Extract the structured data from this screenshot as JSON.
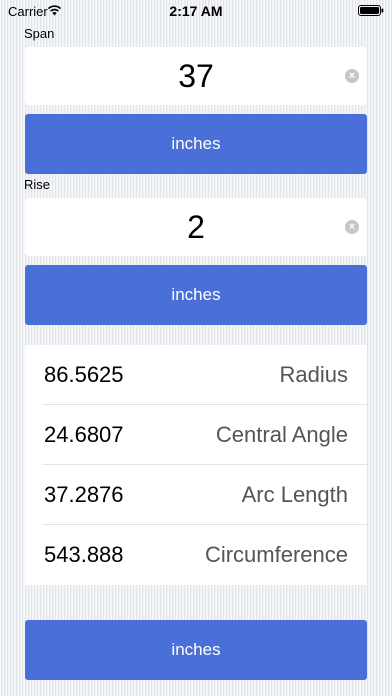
{
  "status_bar": {
    "carrier": "Carrier",
    "time": "2:17 AM",
    "wifi_icon": "wifi-icon",
    "battery_icon": "battery-icon"
  },
  "span": {
    "label": "Span",
    "value": "37",
    "unit_button": "inches",
    "clear_icon": "clear-icon"
  },
  "rise": {
    "label": "Rise",
    "value": "2",
    "unit_button": "inches",
    "clear_icon": "clear-icon"
  },
  "results": [
    {
      "value": "86.5625",
      "label": "Radius"
    },
    {
      "value": "24.6807",
      "label": "Central Angle"
    },
    {
      "value": "37.2876",
      "label": "Arc Length"
    },
    {
      "value": "543.888",
      "label": "Circumference"
    }
  ],
  "output_unit_button": "inches",
  "colors": {
    "button": "#4a6fd8",
    "background": "#eceff3",
    "label_gray": "#555555"
  }
}
